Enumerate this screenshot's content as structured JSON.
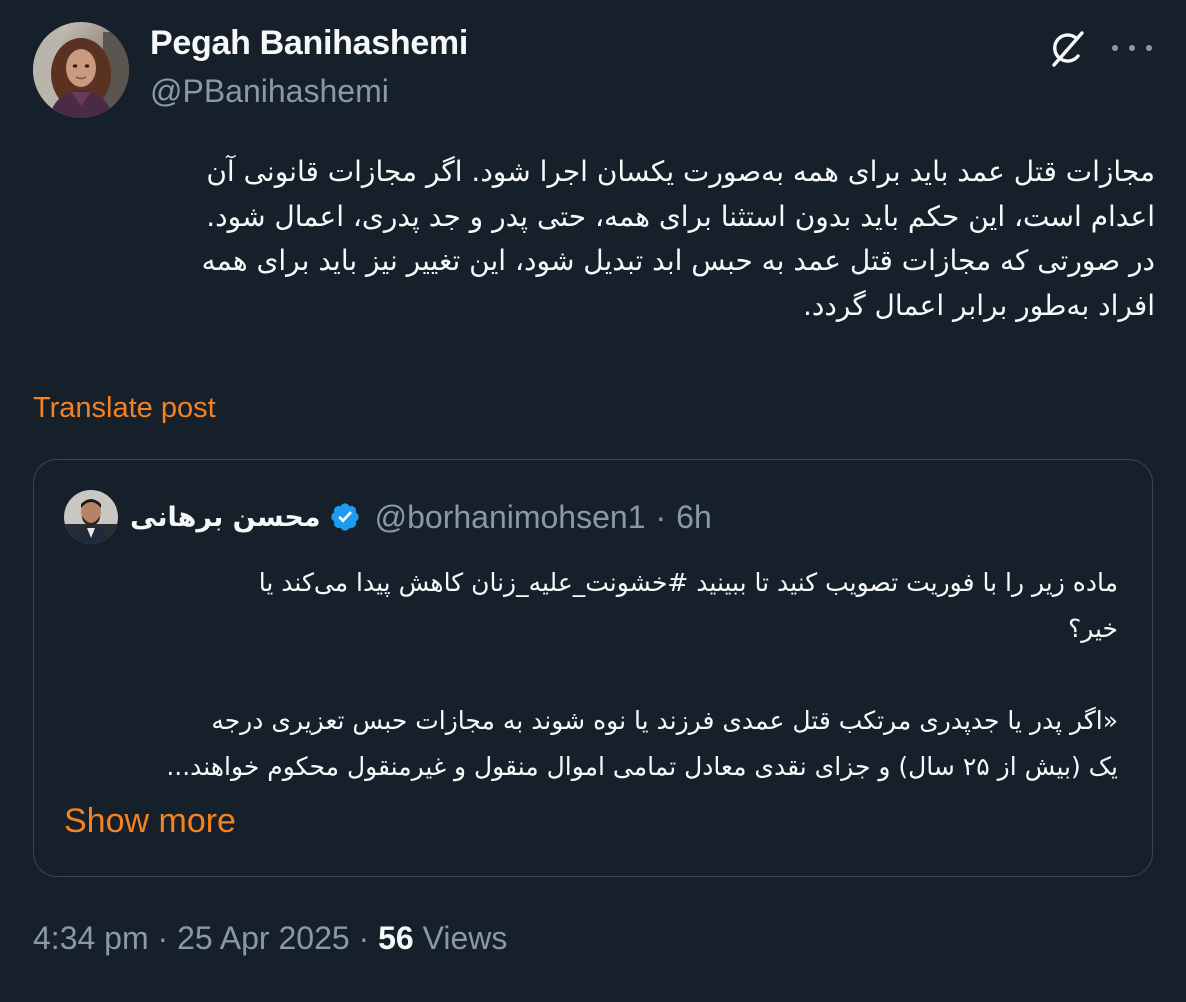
{
  "author": {
    "name": "Pegah Banihashemi",
    "handle": "@PBanihashemi"
  },
  "header_icons": [
    "grok-icon",
    "more-options-icon"
  ],
  "post": {
    "lines": [
      "مجازات قتل عمد باید برای همه به‌صورت یکسان اجرا شود. اگر مجازات قانونی آن",
      "اعدام است، این حکم باید بدون استثنا برای همه، حتی پدر و جد پدری، اعمال شود.",
      "در صورتی که مجازات قتل عمد به حبس ابد تبدیل شود، این تغییر نیز باید برای همه",
      "افراد به‌طور برابر اعمال گردد."
    ],
    "translate_label": "Translate post"
  },
  "quote": {
    "name": "محسن برهانی",
    "verified": true,
    "handle": "@borhanimohsen1",
    "time": "6h",
    "lines": [
      "ماده زیر را با فوریت تصویب کنید تا ببینید #خشونت_علیه_زنان کاهش پیدا می‌کند یا",
      "خیر؟",
      "",
      "«اگر پدر یا جدپدری مرتکب قتل عمدی فرزند یا نوه شوند به مجازات حبس تعزیری درجه",
      "یک (بیش از ۲۵ سال) و جزای نقدی معادل تمامی اموال منقول و غیرمنقول محکوم خواهند..."
    ],
    "show_more_label": "Show more"
  },
  "meta": {
    "time": "4:34 pm",
    "separator": "·",
    "date": "25 Apr 2025",
    "views_count": "56",
    "views_label": "Views"
  },
  "colors": {
    "background": "#15202b",
    "text": "#f7f9f9",
    "secondary": "#8b98a5",
    "accent": "#f4821f",
    "border": "#38444d",
    "verified": "#1d9bf0"
  }
}
